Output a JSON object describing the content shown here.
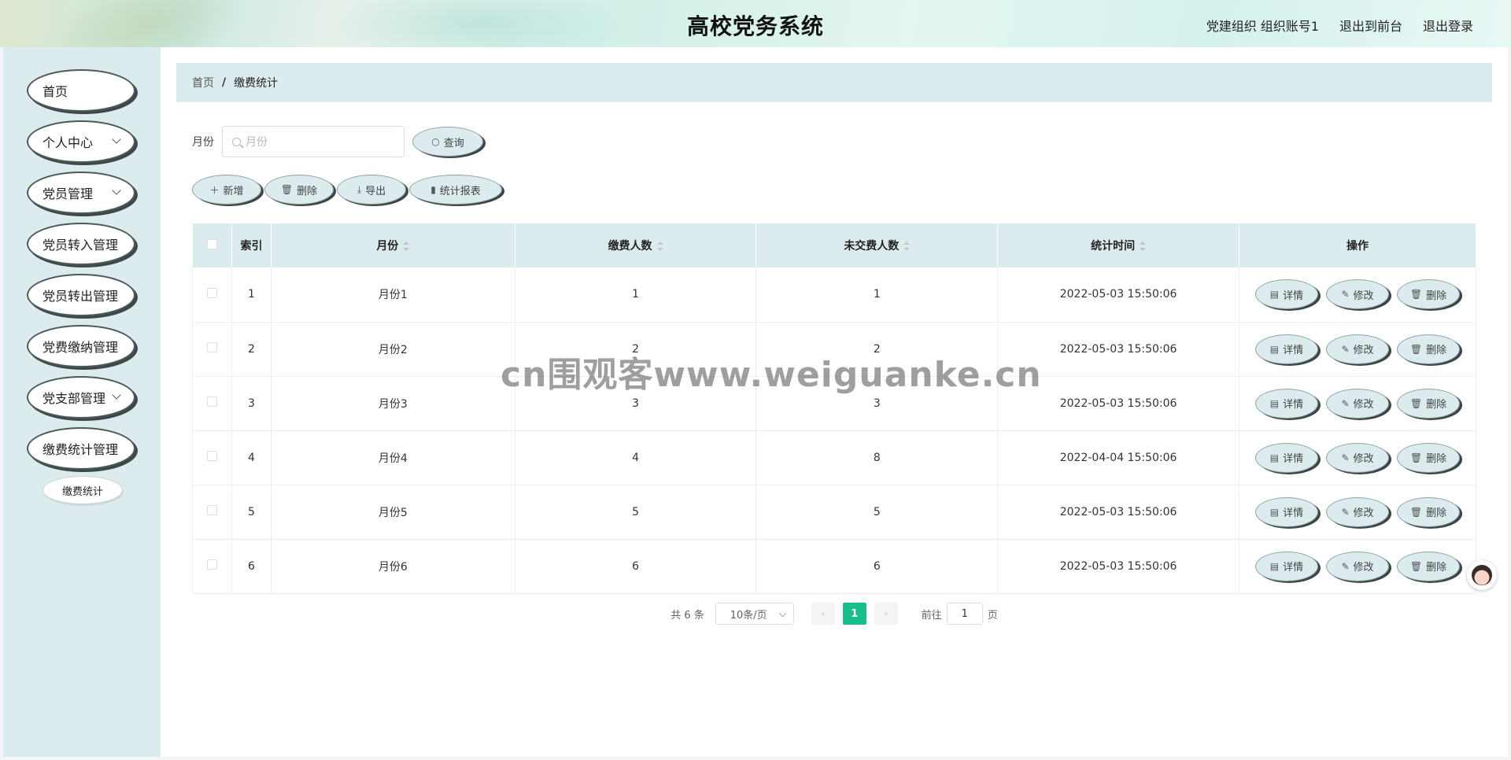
{
  "header": {
    "title": "高校党务系统",
    "user": "党建组织 组织账号1",
    "back_front": "退出到前台",
    "logout": "退出登录"
  },
  "sidebar": {
    "items": [
      {
        "label": "首页",
        "has_children": false
      },
      {
        "label": "个人中心",
        "has_children": true
      },
      {
        "label": "党员管理",
        "has_children": true
      },
      {
        "label": "党员转入管理",
        "has_children": false
      },
      {
        "label": "党员转出管理",
        "has_children": false
      },
      {
        "label": "党费缴纳管理",
        "has_children": false
      },
      {
        "label": "党支部管理",
        "has_children": true
      },
      {
        "label": "缴费统计管理",
        "has_children": false
      }
    ],
    "sub_item": "缴费统计"
  },
  "breadcrumb": {
    "home": "首页",
    "sep": "/",
    "current": "缴费统计"
  },
  "search": {
    "label": "月份",
    "placeholder": "月份",
    "query_button": "查询"
  },
  "actions": {
    "add": "新增",
    "delete": "删除",
    "export": "导出",
    "report": "统计报表"
  },
  "table": {
    "headers": [
      "索引",
      "月份",
      "缴费人数",
      "未交费人数",
      "统计时间",
      "操作"
    ],
    "rows": [
      {
        "index": "1",
        "month": "月份1",
        "paid": "1",
        "unpaid": "1",
        "time": "2022-05-03 15:50:06"
      },
      {
        "index": "2",
        "month": "月份2",
        "paid": "2",
        "unpaid": "2",
        "time": "2022-05-03 15:50:06"
      },
      {
        "index": "3",
        "month": "月份3",
        "paid": "3",
        "unpaid": "3",
        "time": "2022-05-03 15:50:06"
      },
      {
        "index": "4",
        "month": "月份4",
        "paid": "4",
        "unpaid": "8",
        "time": "2022-04-04 15:50:06"
      },
      {
        "index": "5",
        "month": "月份5",
        "paid": "5",
        "unpaid": "5",
        "time": "2022-05-03 15:50:06"
      },
      {
        "index": "6",
        "month": "月份6",
        "paid": "6",
        "unpaid": "6",
        "time": "2022-05-03 15:50:06"
      }
    ],
    "row_actions": {
      "detail": "详情",
      "edit": "修改",
      "delete": "删除"
    }
  },
  "pagination": {
    "total": "共 6 条",
    "page_size": "10条/页",
    "current_page": "1",
    "goto_label": "前往",
    "goto_value": "1",
    "goto_suffix": "页"
  },
  "watermark": "cn围观客www.weiguanke.cn",
  "colors": {
    "accent": "#19be8b",
    "panel": "#dcebed"
  }
}
